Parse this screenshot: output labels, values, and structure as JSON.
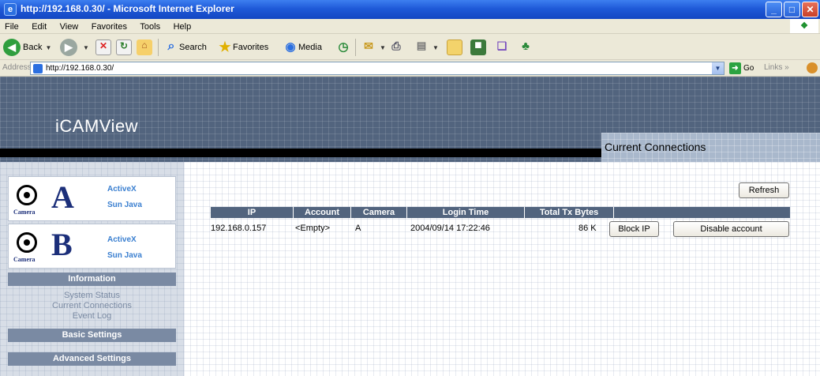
{
  "window": {
    "title": "http://192.168.0.30/ - Microsoft Internet Explorer",
    "min_label": "_",
    "max_label": "□",
    "close_label": "✕"
  },
  "menu": {
    "items": [
      "File",
      "Edit",
      "View",
      "Favorites",
      "Tools",
      "Help"
    ]
  },
  "toolbar": {
    "back_label": "Back",
    "search_label": "Search",
    "favorites_label": "Favorites",
    "media_label": "Media"
  },
  "address": {
    "label": "Address",
    "url": "http://192.168.0.30/",
    "go_label": "Go",
    "links_label": "Links"
  },
  "page": {
    "brand": "iCAMView",
    "heading": "Current Connections"
  },
  "sidebar": {
    "camera_word": "Camera",
    "cameras": [
      {
        "letter": "A",
        "activex": "ActiveX",
        "sunjava": "Sun Java"
      },
      {
        "letter": "B",
        "activex": "ActiveX",
        "sunjava": "Sun Java"
      }
    ],
    "information_title": "Information",
    "links": [
      "System Status",
      "Current Connections",
      "Event Log"
    ],
    "basic_settings": "Basic Settings",
    "advanced_settings": "Advanced Settings"
  },
  "main": {
    "refresh_label": "Refresh",
    "columns": [
      "IP",
      "Account",
      "Camera",
      "Login Time",
      "Total Tx Bytes"
    ],
    "rows": [
      {
        "ip": "192.168.0.157",
        "account": "<Empty>",
        "camera": "A",
        "login_time": "2004/09/14 17:22:46",
        "tx_bytes": "86 K",
        "block_label": "Block IP",
        "disable_label": "Disable account"
      }
    ]
  },
  "colors": {
    "header_bg": "#52647e",
    "section_bg": "#7a8aa3",
    "link_blue": "#3a7fd0"
  }
}
